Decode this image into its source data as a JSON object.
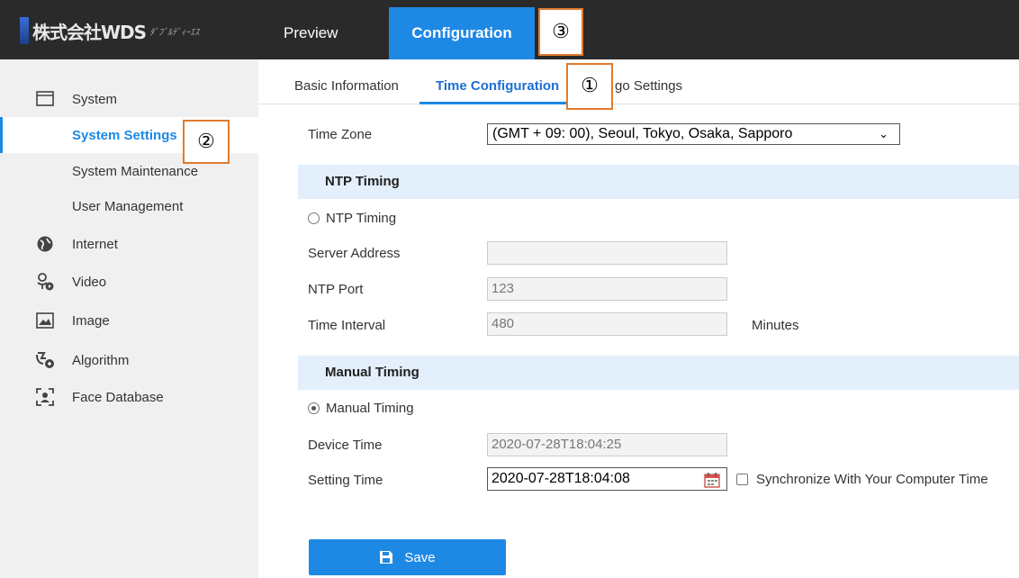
{
  "app": {
    "logo_text": "株式会社WDS",
    "logo_sub": "ﾀﾞﾌﾞﾙﾃﾞｨｰｴｽ"
  },
  "topnav": {
    "preview": "Preview",
    "configuration": "Configuration"
  },
  "callouts": {
    "one": "①",
    "two": "②",
    "three": "③"
  },
  "sidebar": {
    "items": [
      {
        "label": "System",
        "icon": "monitor-icon"
      },
      {
        "label": "System Settings",
        "icon": ""
      },
      {
        "label": "System Maintenance",
        "icon": ""
      },
      {
        "label": "User Management",
        "icon": ""
      },
      {
        "label": "Internet",
        "icon": "globe-icon"
      },
      {
        "label": "Video",
        "icon": "video-icon"
      },
      {
        "label": "Image",
        "icon": "image-icon"
      },
      {
        "label": "Algorithm",
        "icon": "algorithm-icon"
      },
      {
        "label": "Face Database",
        "icon": "face-icon"
      }
    ],
    "active": "System Settings"
  },
  "subtabs": {
    "basic": "Basic Information",
    "time": "Time Configuration",
    "algo": "go Settings"
  },
  "form": {
    "time_zone_label": "Time Zone",
    "time_zone_value": "(GMT + 09: 00), Seoul, Tokyo, Osaka, Sapporo",
    "ntp_section": "NTP Timing",
    "ntp_radio": "NTP Timing",
    "ntp_selected": false,
    "server_address_label": "Server Address",
    "server_address_value": "",
    "ntp_port_label": "NTP Port",
    "ntp_port_value": "123",
    "time_interval_label": "Time Interval",
    "time_interval_value": "480",
    "time_interval_unit": "Minutes",
    "manual_section": "Manual Timing",
    "manual_radio": "Manual Timing",
    "manual_selected": true,
    "device_time_label": "Device Time",
    "device_time_value": "2020-07-28T18:04:25",
    "setting_time_label": "Setting Time",
    "setting_time_value": "2020-07-28T18:04:08",
    "sync_label": "Synchronize With Your Computer Time",
    "sync_checked": false,
    "save_label": "Save"
  },
  "colors": {
    "accent": "#1e88e5",
    "topbar": "#2a2a2a",
    "sidebar": "#f0f0f0",
    "section": "#e3effb",
    "callout_border": "#e07b2e"
  }
}
